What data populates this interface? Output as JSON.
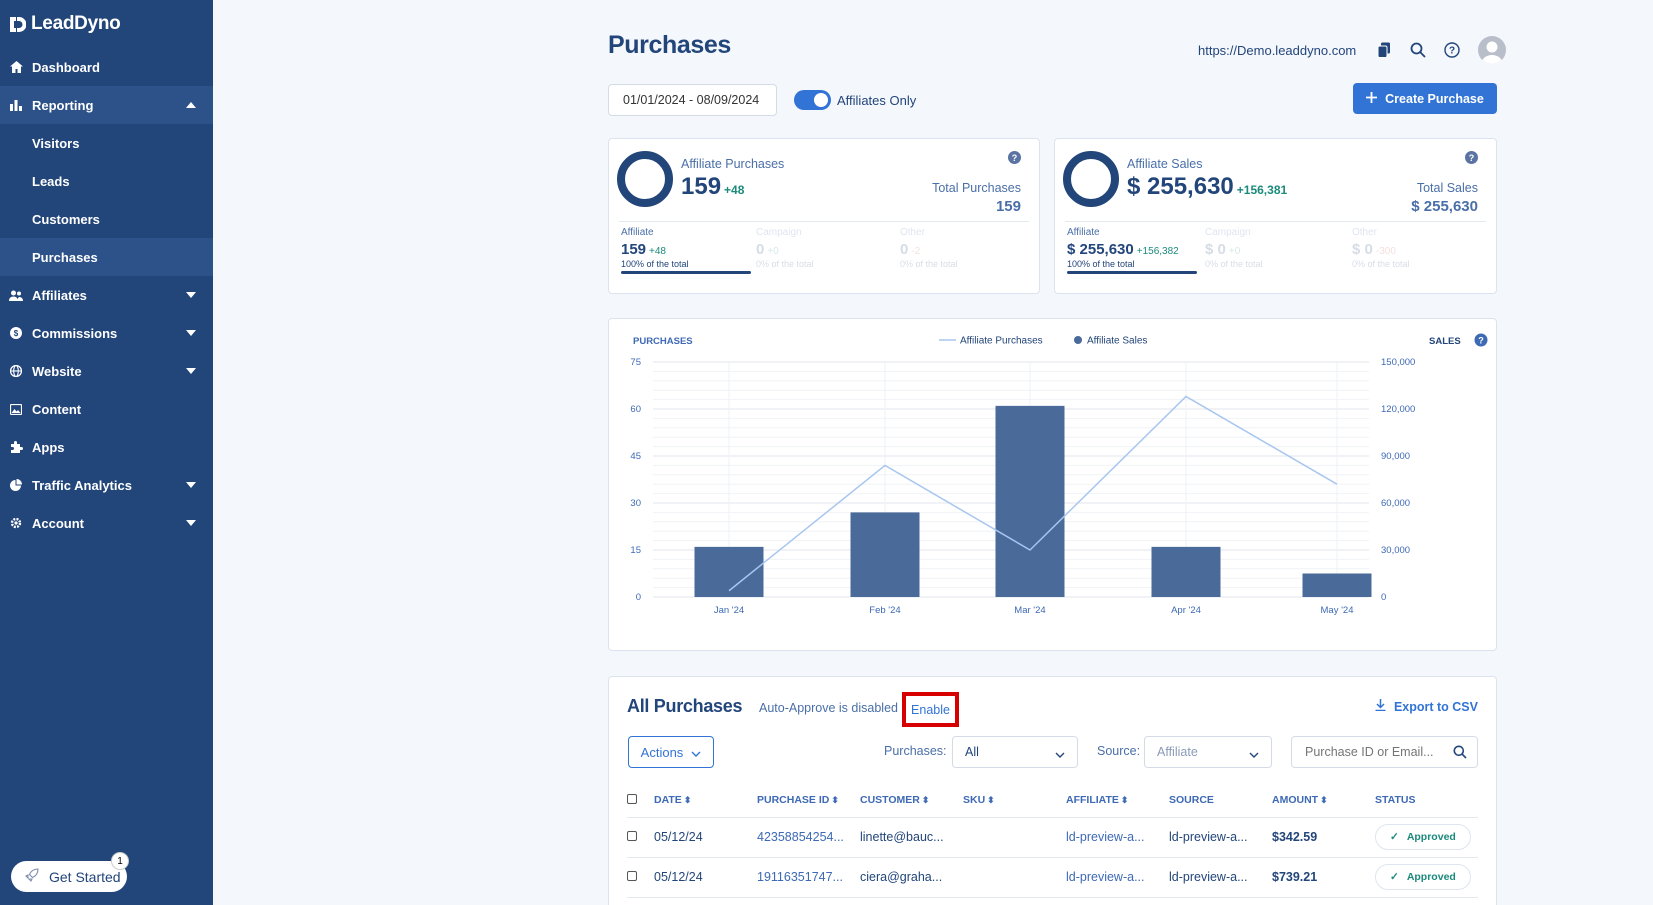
{
  "sidebar": {
    "brand": "LeadDyno",
    "items": [
      {
        "label": "Dashboard"
      },
      {
        "label": "Reporting"
      },
      {
        "label": "Affiliates"
      },
      {
        "label": "Commissions"
      },
      {
        "label": "Website"
      },
      {
        "label": "Content"
      },
      {
        "label": "Apps"
      },
      {
        "label": "Traffic Analytics"
      },
      {
        "label": "Account"
      }
    ],
    "reporting_sub": [
      "Visitors",
      "Leads",
      "Customers",
      "Purchases"
    ],
    "get_started": "Get Started",
    "get_started_badge": "1"
  },
  "header": {
    "title": "Purchases",
    "url": "https://Demo.leaddyno.com"
  },
  "toolbar": {
    "date_range": "01/01/2024 - 08/09/2024",
    "affiliates_only": "Affiliates Only",
    "create_purchase": "Create Purchase"
  },
  "stats": [
    {
      "label": "Affiliate Purchases",
      "value": "159",
      "delta": "+48",
      "total_label": "Total Purchases",
      "total_value": "159",
      "breakdown": [
        {
          "title": "Affiliate",
          "value": "159",
          "delta": "+48",
          "pct": "100% of the total"
        },
        {
          "title": "Campaign",
          "value": "0",
          "delta": "+0",
          "pct": "0% of the total"
        },
        {
          "title": "Other",
          "value": "0",
          "delta": "-2",
          "pct": "0% of the total"
        }
      ]
    },
    {
      "label": "Affiliate Sales",
      "value": "$ 255,630",
      "delta": "+156,381",
      "total_label": "Total Sales",
      "total_value": "$ 255,630",
      "breakdown": [
        {
          "title": "Affiliate",
          "value": "$ 255,630",
          "delta": "+156,382",
          "pct": "100% of the total"
        },
        {
          "title": "Campaign",
          "value": "$ 0",
          "delta": "+0",
          "pct": "0% of the total"
        },
        {
          "title": "Other",
          "value": "$ 0",
          "delta": "-300",
          "pct": "0% of the total"
        }
      ]
    }
  ],
  "chart_data": {
    "type": "bar",
    "categories": [
      "Jan '24",
      "Feb '24",
      "Mar '24",
      "Apr '24",
      "May '24"
    ],
    "series": [
      {
        "name": "Affiliate Sales",
        "type": "bar",
        "axis": "left",
        "values": [
          16,
          27,
          61,
          16,
          7.5
        ]
      },
      {
        "name": "Affiliate Purchases",
        "type": "line",
        "axis": "right",
        "values": [
          4000,
          84000,
          30000,
          128000,
          72000
        ]
      }
    ],
    "ylabel": "PURCHASES",
    "y2label": "SALES",
    "ylim": [
      0,
      75
    ],
    "y2lim": [
      0,
      150000
    ],
    "yticks": [
      "0",
      "15",
      "30",
      "45",
      "60",
      "75"
    ],
    "y2ticks": [
      "0",
      "30,000",
      "60,000",
      "90,000",
      "120,000",
      "150,000"
    ],
    "bar_color": "#4a6a9a",
    "line_color": "#a8c6ef",
    "grid": true,
    "legend": "top-center"
  },
  "purchases": {
    "title": "All Purchases",
    "auto_approve": "Auto-Approve is disabled",
    "enable": "Enable",
    "export": "Export to CSV",
    "actions": "Actions",
    "purchases_filter_label": "Purchases:",
    "purchases_filter_value": "All",
    "source_label": "Source:",
    "source_placeholder": "Affiliate",
    "search_placeholder": "Purchase ID or Email...",
    "columns": [
      "DATE",
      "PURCHASE ID",
      "CUSTOMER",
      "SKU",
      "AFFILIATE",
      "SOURCE",
      "AMOUNT",
      "STATUS"
    ],
    "rows": [
      {
        "date": "05/12/24",
        "id": "42358854254...",
        "customer": "linette@bauc...",
        "sku": "",
        "affiliate": "ld-preview-a...",
        "source": "ld-preview-a...",
        "amount": "$342.59",
        "status": "Approved"
      },
      {
        "date": "05/12/24",
        "id": "19116351747...",
        "customer": "ciera@graha...",
        "sku": "",
        "affiliate": "ld-preview-a...",
        "source": "ld-preview-a...",
        "amount": "$739.21",
        "status": "Approved"
      }
    ]
  }
}
